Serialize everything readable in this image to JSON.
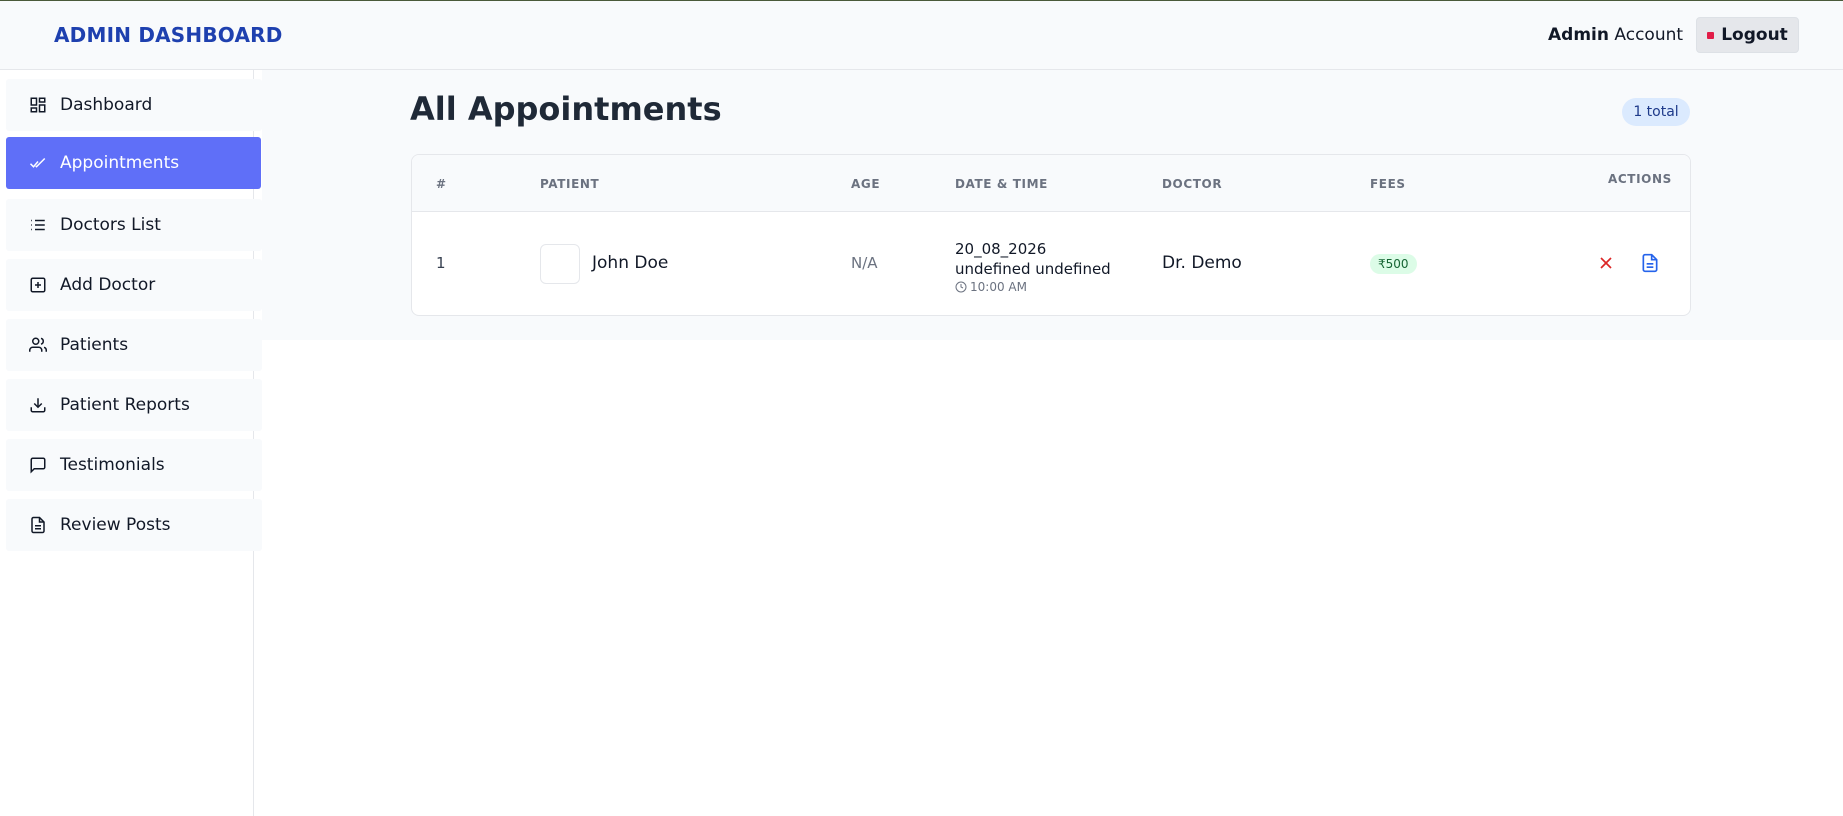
{
  "header": {
    "brand": "ADMIN DASHBOARD",
    "account_bold": "Admin",
    "account_rest": "Account",
    "logout_label": "Logout"
  },
  "sidebar": {
    "items": [
      {
        "label": "Dashboard",
        "icon": "dashboard-icon",
        "active": false
      },
      {
        "label": "Appointments",
        "icon": "double-check-icon",
        "active": true
      },
      {
        "label": "Doctors List",
        "icon": "list-icon",
        "active": false
      },
      {
        "label": "Add Doctor",
        "icon": "plus-square-icon",
        "active": false
      },
      {
        "label": "Patients",
        "icon": "users-icon",
        "active": false
      },
      {
        "label": "Patient Reports",
        "icon": "download-icon",
        "active": false
      },
      {
        "label": "Testimonials",
        "icon": "message-icon",
        "active": false
      },
      {
        "label": "Review Posts",
        "icon": "document-icon",
        "active": false
      }
    ]
  },
  "main": {
    "title": "All Appointments",
    "total_badge": "1 total",
    "table": {
      "headers": [
        "#",
        "PATIENT",
        "AGE",
        "DATE & TIME",
        "DOCTOR",
        "FEES",
        "ACTIONS"
      ],
      "rows": [
        {
          "index": "1",
          "patient": "John Doe",
          "age": "N/A",
          "date": "20_08_2026 undefined undefined",
          "time": "10:00 AM",
          "doctor": "Dr. Demo",
          "fees": "₹500"
        }
      ]
    }
  },
  "colors": {
    "brand": "#1e40af",
    "active_nav": "#5f6ff8",
    "cancel": "#dc2626",
    "document": "#2563eb",
    "fee_badge_bg": "#dcfce7",
    "total_badge_bg": "#dbeafe"
  }
}
